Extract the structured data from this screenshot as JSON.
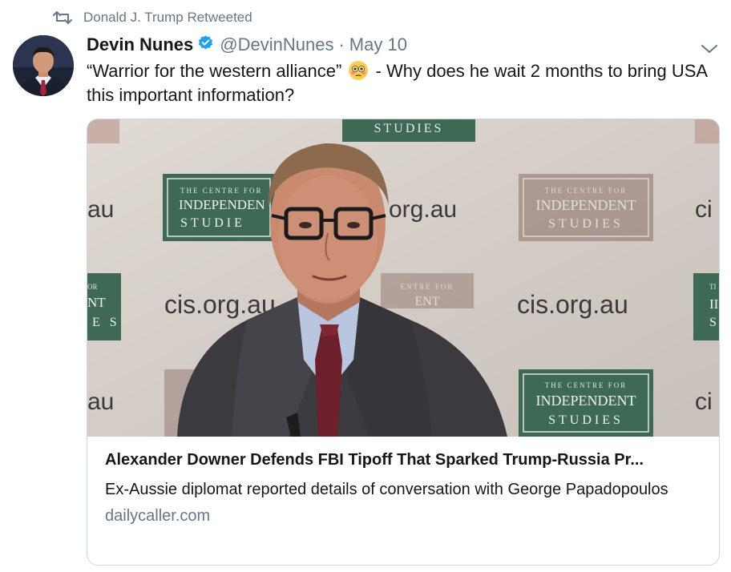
{
  "retweet": {
    "icon": "retweet-icon",
    "text": "Donald J. Trump Retweeted"
  },
  "tweet": {
    "author_name": "Devin Nunes",
    "verified": true,
    "handle": "@DevinNunes",
    "separator": "·",
    "date": "May 10",
    "text_before_emoji": "“Warrior for the western alliance”",
    "emoji": "flushed-face-emoji",
    "text_after_emoji": " - Why does he wait 2 months to bring USA this important information?"
  },
  "card": {
    "title": "Alexander Downer Defends FBI Tipoff That Sparked Trump-Russia Pr...",
    "description": "Ex-Aussie diplomat reported details of conversation with George Papadopoulos",
    "domain": "dailycaller.com",
    "backdrop": {
      "url_text": "cis.org.au",
      "url_fragment_left": "au",
      "url_fragment_right": "ci",
      "url_fragment_top": "org.au",
      "sign_line1": "THE CENTRE FOR",
      "sign_line2": "INDEPENDENT",
      "sign_line3": "STUDIES",
      "sign_line2_partial": "INDEPENDEN",
      "sign_line3_partial": "STUDIE",
      "sign_line1_faded": "ENTRE FOR",
      "sign_line2_faded": "ENT"
    }
  },
  "colors": {
    "text": "#14171a",
    "secondary": "#657786",
    "verified_blue": "#1da1f2",
    "border": "#ccd6dd",
    "sign_green": "#3e6a55"
  }
}
